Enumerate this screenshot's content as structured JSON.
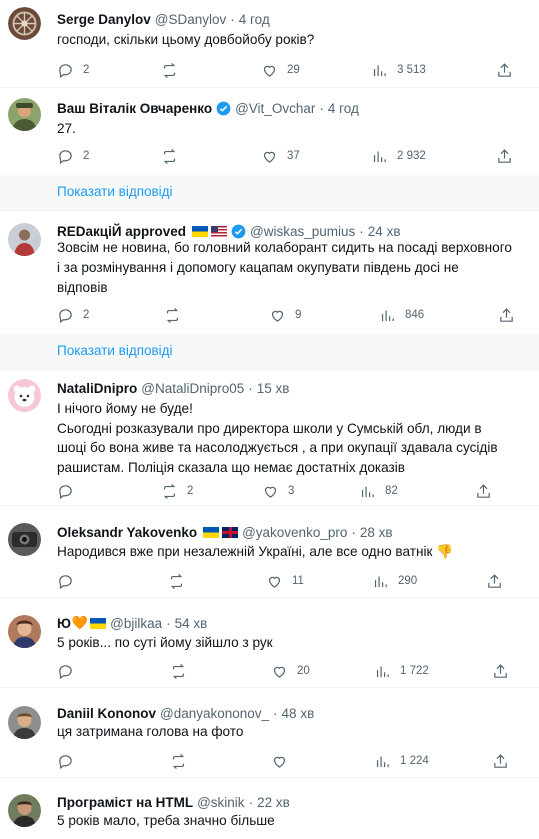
{
  "show_replies": "Показати відповіді",
  "tweets": [
    {
      "name": "Serge Danylov",
      "handle": "@SDanylov",
      "time": "4 год",
      "text": [
        "господи, скільки цьому довбойобу років?"
      ],
      "replies": "2",
      "retweets": "",
      "likes": "29",
      "views": "3 513",
      "avatar_icon": "user-avatar-icon"
    },
    {
      "name": "Ваш Віталік Овчаренко",
      "handle": "@Vit_Ovchar",
      "time": "4 год",
      "text": [
        "27."
      ],
      "replies": "2",
      "retweets": "",
      "likes": "37",
      "views": "2 932",
      "verified": true
    },
    {
      "name": "REDакціЙ approved",
      "handle": "@wiskas_pumius",
      "time": "24 хв",
      "text": [
        "Зовсім не новина, бо головний колаборант сидить на посаді верховного",
        "і за розмінування і допомогу кацапам окупувати південь досі не",
        "відповів"
      ],
      "replies": "2",
      "retweets": "",
      "likes": "9",
      "views": "846",
      "verified": true,
      "flags": [
        "ua",
        "us"
      ]
    },
    {
      "name": "NataliDnipro",
      "handle": "@NataliDnipro05",
      "time": "15 хв",
      "text": [
        "І нічого йому не буде!",
        "Сьогодні розказували про директора школи у Сумській обл, люди в",
        "шоці бо вона живе та насолоджується , а при окупації здавала сусідів",
        "рашистам. Поліція сказала що немає достатніх доказів"
      ],
      "replies": "",
      "retweets": "2",
      "likes": "3",
      "views": "82"
    },
    {
      "name": "Oleksandr Yakovenko",
      "handle": "@yakovenko_pro",
      "time": "28 хв",
      "text": [
        "Народився вже при незалежній Україні, але все одно ватнік"
      ],
      "replies": "",
      "retweets": "",
      "likes": "11",
      "views": "290",
      "flags": [
        "ua",
        "uk"
      ],
      "emoji": "👎"
    },
    {
      "name": "Ю",
      "handle": "@bjilkaa",
      "time": "54 хв",
      "text": [
        "5 років... по суті йому зійшло з рук"
      ],
      "replies": "",
      "retweets": "",
      "likes": "20",
      "views": "1 722",
      "heart": "🧡",
      "flags": [
        "ua"
      ]
    },
    {
      "name": "Daniil Kononov",
      "handle": "@danyakononov_",
      "time": "48 хв",
      "text": [
        "ця затримана голова на фото"
      ],
      "replies": "",
      "retweets": "",
      "likes": "",
      "views": "1 224"
    },
    {
      "name": "Програміст на HTML",
      "handle": "@skinik",
      "time": "22 хв",
      "text": [
        "5 років мало, треба значно більше"
      ],
      "replies": "",
      "retweets": "",
      "likes": "",
      "views": ""
    }
  ],
  "colors": {
    "link": "#1d9bf0",
    "muted": "#536471",
    "text": "#0f1419",
    "separator": "#eff3f4"
  }
}
